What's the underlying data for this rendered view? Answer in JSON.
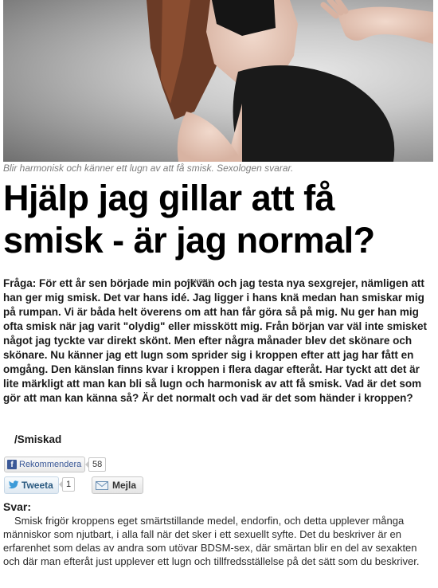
{
  "hero": {
    "image": "model-in-black-underwear-with-raised-hand"
  },
  "caption": "Blir harmonisk och känner ett lugn av att få smisk. Sexologen svarar.",
  "headline": "Hjälp jag gillar att få smisk - är jag normal?",
  "question": {
    "label": "Fråga:",
    "text": "För ett år sen började min pojkvän och jag testa nya sexgrejer, nämligen att han ger mig smisk. Det var hans idé. Jag ligger i hans knä medan han smiskar mig på rumpan. Vi är båda helt överens om att han får göra så på mig. Nu ger han mig ofta smisk när jag varit \"olydig\" eller misskött mig. Från början var väl inte smisket något jag tyckte var direkt skönt. Men efter några månader blev det skönare och skönare. Nu känner jag ett lugn som sprider sig i kroppen efter att jag har fått en omgång. Den känslan finns kvar i kroppen i flera dagar efteråt. Har tyckt att det är lite märkligt att man kan bli så lugn och harmonisk av att få smisk. Vad är det som gör att man kan känna så? Är det normalt och vad är det som händer i kroppen?",
    "ad_label": "ANNONS:",
    "signature": "/Smiskad"
  },
  "social": {
    "facebook": {
      "icon": "facebook-icon",
      "label": "Rekommendera",
      "count": "58",
      "color": "#3b5998"
    },
    "twitter": {
      "icon": "twitter-bird-icon",
      "label": "Tweeta",
      "count": "1"
    },
    "mail": {
      "icon": "envelope-icon",
      "label": "Mejla"
    }
  },
  "answer": {
    "label": "Svar:",
    "text": "Smisk frigör kroppens eget smärtstillande medel, endorfin, och detta upplever många människor som njutbart, i alla fall när det sker i ett sexuellt syfte. Det du beskriver är en erfarenhet som delas av andra som utövar BDSM-sex, där smärtan blir en del av sexakten och där man efteråt just upplever ett lugn och tillfredsställelse på det sätt som du beskriver."
  }
}
